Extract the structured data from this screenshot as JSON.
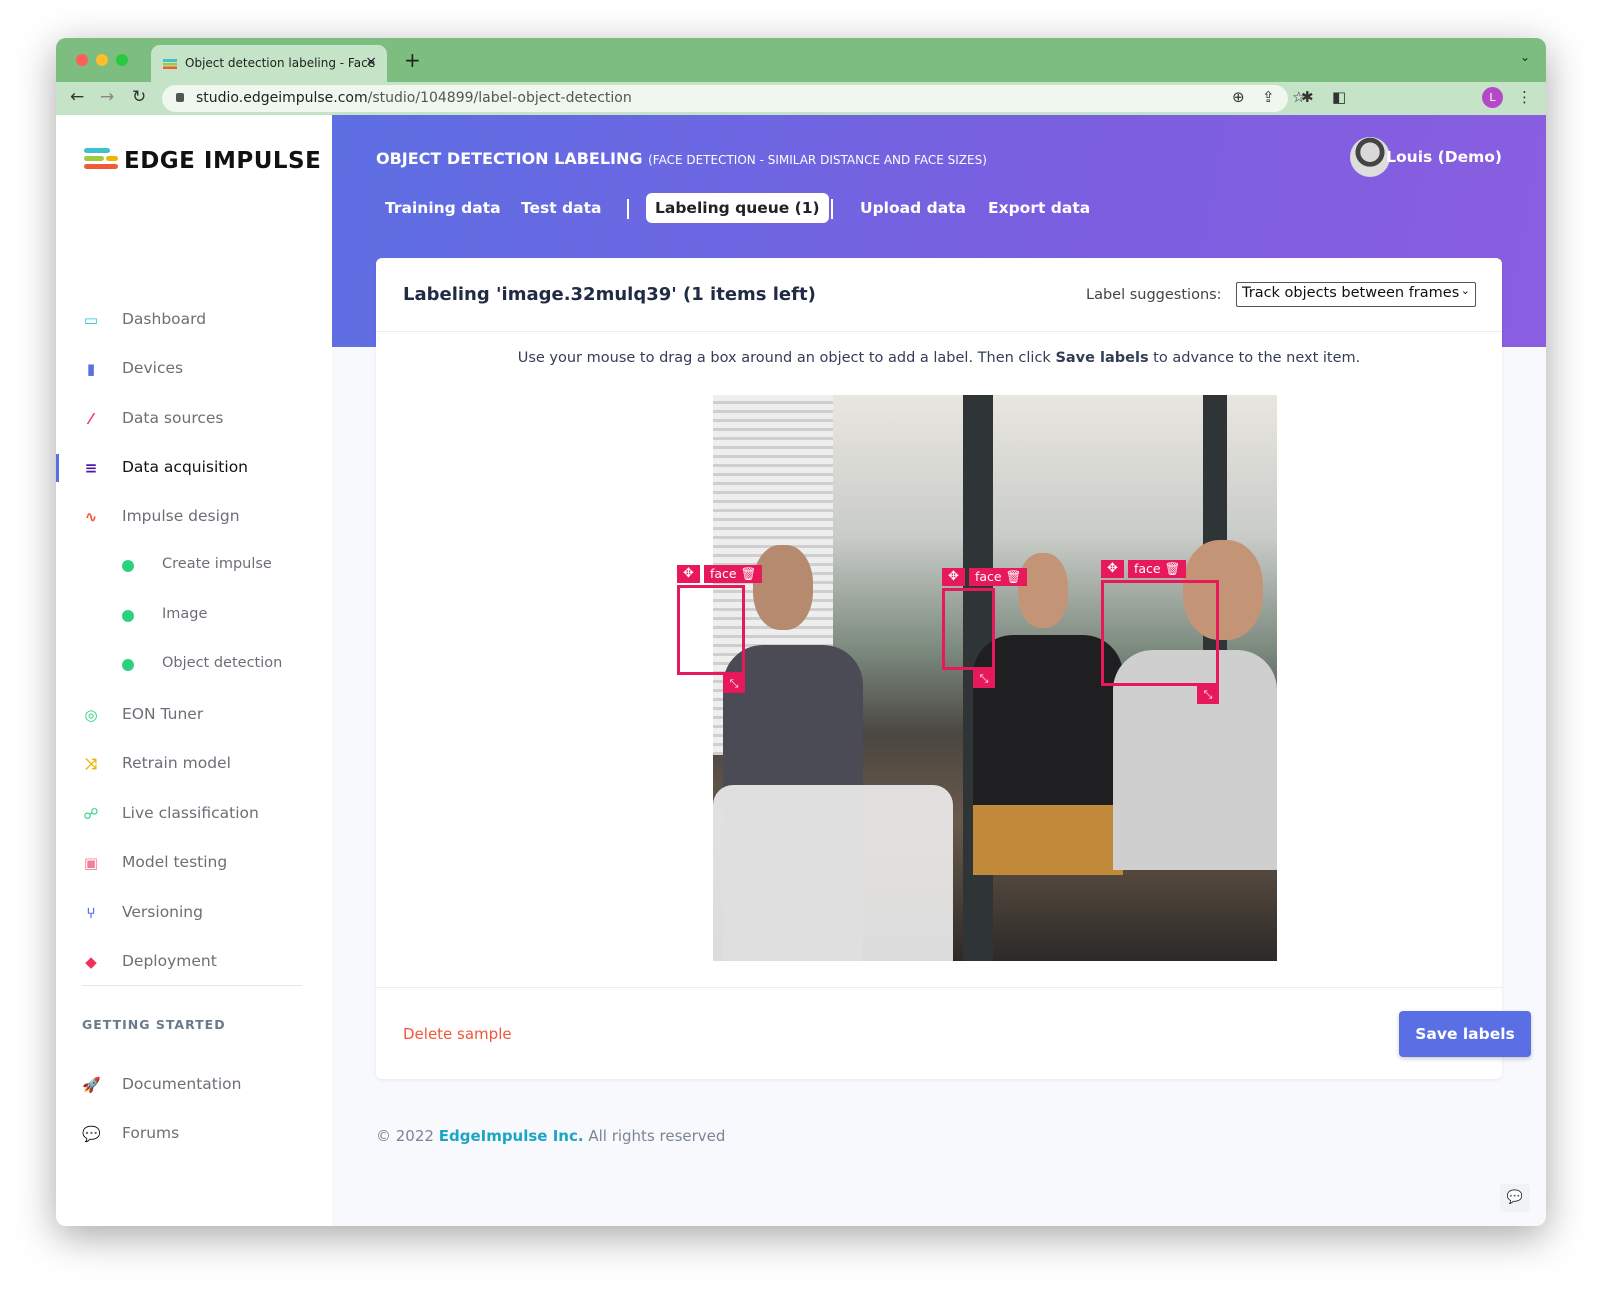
{
  "browser": {
    "tab_title": "Object detection labeling - Face",
    "url_host": "studio.edgeimpulse.com",
    "url_path": "/studio/104899/label-object-detection",
    "profile_initial": "L",
    "new_tab": "+",
    "close": "×"
  },
  "sidebar": {
    "logo": "EDGE IMPULSE",
    "items": [
      {
        "label": "Dashboard",
        "icon": "monitor-icon",
        "color": "#25c4e8"
      },
      {
        "label": "Devices",
        "icon": "chip-icon",
        "color": "#5a6fe3"
      },
      {
        "label": "Data sources",
        "icon": "magic-wand-icon",
        "color": "#f0325a"
      },
      {
        "label": "Data acquisition",
        "icon": "database-icon",
        "color": "#4b16a8",
        "active": true
      },
      {
        "label": "Impulse design",
        "icon": "pulse-icon",
        "color": "#f0573a"
      },
      {
        "label": "Create impulse",
        "sub": true
      },
      {
        "label": "Image",
        "sub": true
      },
      {
        "label": "Object detection",
        "sub": true
      },
      {
        "label": "EON Tuner",
        "icon": "compass-icon",
        "color": "#2ed080"
      },
      {
        "label": "Retrain model",
        "icon": "shuffle-icon",
        "color": "#f0b400"
      },
      {
        "label": "Live classification",
        "icon": "network-icon",
        "color": "#2ed080"
      },
      {
        "label": "Model testing",
        "icon": "clipboard-check-icon",
        "color": "#f27d9a"
      },
      {
        "label": "Versioning",
        "icon": "git-branch-icon",
        "color": "#5a6fe3"
      },
      {
        "label": "Deployment",
        "icon": "cube-icon",
        "color": "#f0325a"
      }
    ],
    "getting_started": "GETTING STARTED",
    "links": [
      {
        "label": "Documentation",
        "icon": "rocket-icon"
      },
      {
        "label": "Forums",
        "icon": "chat-icon"
      }
    ]
  },
  "header": {
    "title": "OBJECT DETECTION LABELING",
    "subtitle": "(FACE DETECTION - SIMILAR DISTANCE AND FACE SIZES)",
    "tabs": [
      {
        "label": "Training data"
      },
      {
        "label": "Test data"
      },
      {
        "label": "Labeling queue (1)",
        "active": true
      },
      {
        "label": "Upload data"
      },
      {
        "label": "Export data"
      }
    ],
    "user": "Louis (Demo)"
  },
  "card": {
    "title": "Labeling 'image.32mulq39' (1 items left)",
    "suggestions_label": "Label suggestions:",
    "suggestions_value": "Track objects between frames",
    "instruction_pre": "Use your mouse to drag a box around an object to add a label. Then click ",
    "instruction_bold": "Save labels",
    "instruction_post": " to advance to the next item.",
    "boxes": [
      {
        "label": "face"
      },
      {
        "label": "face"
      },
      {
        "label": "face"
      }
    ],
    "delete": "Delete sample",
    "save": "Save labels",
    "accent": "#5a6fe3",
    "box_color": "#e8195a"
  },
  "footer": {
    "copy": "© 2022 ",
    "company": "EdgeImpulse Inc.",
    "rights": " All rights reserved"
  }
}
